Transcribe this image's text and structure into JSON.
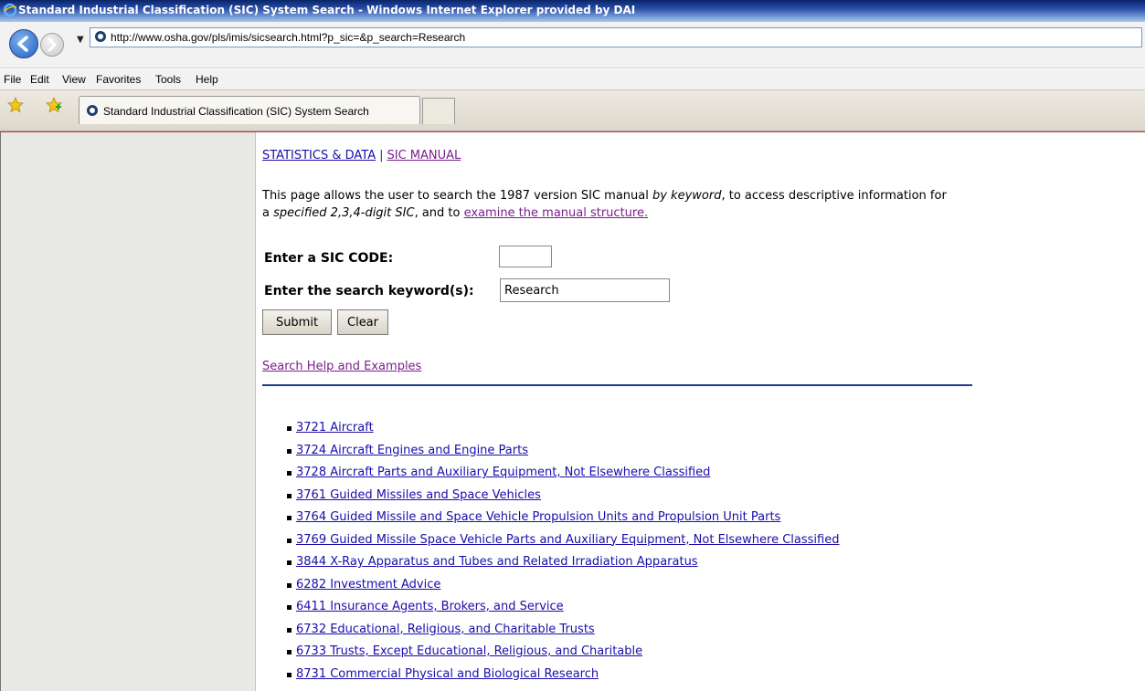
{
  "window": {
    "title": "Standard Industrial Classification (SIC) System Search - Windows Internet Explorer provided by DAI"
  },
  "address": {
    "url": "http://www.osha.gov/pls/imis/sicsearch.html?p_sic=&p_search=Research"
  },
  "menu": [
    "File",
    "Edit",
    "View",
    "Favorites",
    "Tools",
    "Help"
  ],
  "tab": {
    "label": "Standard Industrial Classification (SIC) System Search"
  },
  "page": {
    "nav": {
      "statistics": "STATISTICS & DATA",
      "separator": "|",
      "sic_manual": "SIC MANUAL"
    },
    "description": {
      "part1": "This page allows the user to search the 1987 version SIC manual ",
      "italic1": "by keyword",
      "part2": ", to access descriptive information for a ",
      "italic2": "specified 2,3,4-digit SIC",
      "part3": ", and to ",
      "link": "examine the manual structure."
    },
    "form": {
      "sic_label": "Enter a SIC CODE:",
      "sic_value": "",
      "keyword_label": "Enter the search keyword(s):",
      "keyword_value": "Research",
      "submit": "Submit",
      "clear": "Clear"
    },
    "help_link": "Search Help and Examples",
    "results": [
      "3721 Aircraft",
      "3724 Aircraft Engines and Engine Parts",
      "3728 Aircraft Parts and Auxiliary Equipment, Not Elsewhere Classified",
      "3761 Guided Missiles and Space Vehicles",
      "3764 Guided Missile and Space Vehicle Propulsion Units and Propulsion Unit Parts",
      "3769 Guided Missile Space Vehicle Parts and Auxiliary Equipment, Not Elsewhere Classified",
      "3844 X-Ray Apparatus and Tubes and Related Irradiation Apparatus",
      "6282 Investment Advice",
      "6411 Insurance Agents, Brokers, and Service",
      "6732 Educational, Religious, and Charitable Trusts",
      "6733 Trusts, Except Educational, Religious, and Charitable",
      "8731 Commercial Physical and Biological Research"
    ]
  },
  "icons": {
    "titlebar": "ie-logo-icon",
    "back": "back-arrow-icon",
    "forward": "forward-arrow-icon",
    "page": "page-icon",
    "favorites": "favorites-star-icon",
    "add_favorites": "add-favorites-icon"
  }
}
